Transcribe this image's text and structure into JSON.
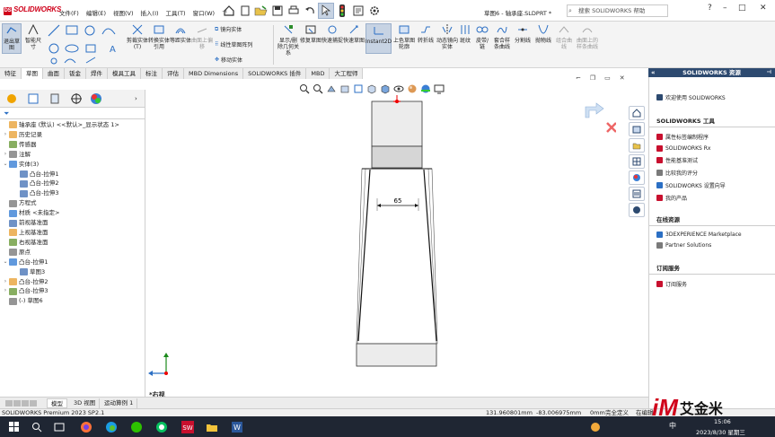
{
  "app": {
    "logo_text": "SOLIDWORKS",
    "title": "草图6 - 轴承座.SLDPRT *",
    "search_placeholder": "搜索 SOLIDWORKS 帮助",
    "accent_red": "#d0021b"
  },
  "menu": [
    "文件(F)",
    "编辑(E)",
    "视图(V)",
    "插入(I)",
    "工具(T)",
    "窗口(W)"
  ],
  "ribbon": {
    "buttons": [
      "退出草图",
      "智能尺寸",
      "剪裁实体(T)",
      "转换实体引用",
      "等距实体",
      "曲面上偏移",
      "显示/删除几何关系",
      "修复草图",
      "快速捕捉",
      "快速草图",
      "Instant2D",
      "上色草图轮廓",
      "转折线",
      "动态镜向实体",
      "斑纹",
      "皮带/链",
      "套合样条曲线",
      "分割线",
      "抛物线",
      "组合曲线",
      "曲面上的样条曲线"
    ],
    "mirror_label": "镜向实体",
    "linear_pattern_label": "线性草图阵列",
    "move_label": "移动实体"
  },
  "tabs": [
    "特征",
    "草图",
    "曲面",
    "钣金",
    "焊件",
    "模具工具",
    "标注",
    "评估",
    "MBD Dimensions",
    "SOLIDWORKS 插件",
    "MBD",
    "大工程师"
  ],
  "tabs_active_index": 1,
  "tree": [
    {
      "label": "轴承座 (默认) <<默认>_显示状态 1>",
      "indent": 0,
      "tw": ""
    },
    {
      "label": "历史记录",
      "indent": 0,
      "tw": "›"
    },
    {
      "label": "传感器",
      "indent": 0,
      "tw": ""
    },
    {
      "label": "注解",
      "indent": 0,
      "tw": "›"
    },
    {
      "label": "实体(3)",
      "indent": 0,
      "tw": "⌄"
    },
    {
      "label": "凸台-拉伸1",
      "indent": 1,
      "tw": ""
    },
    {
      "label": "凸台-拉伸2",
      "indent": 1,
      "tw": ""
    },
    {
      "label": "凸台-拉伸3",
      "indent": 1,
      "tw": ""
    },
    {
      "label": "方程式",
      "indent": 0,
      "tw": ""
    },
    {
      "label": "材质 <未指定>",
      "indent": 0,
      "tw": ""
    },
    {
      "label": "前视基准面",
      "indent": 0,
      "tw": ""
    },
    {
      "label": "上视基准面",
      "indent": 0,
      "tw": ""
    },
    {
      "label": "右视基准面",
      "indent": 0,
      "tw": ""
    },
    {
      "label": "原点",
      "indent": 0,
      "tw": ""
    },
    {
      "label": "凸台-拉伸1",
      "indent": 0,
      "tw": "⌄"
    },
    {
      "label": "草图3",
      "indent": 1,
      "tw": ""
    },
    {
      "label": "凸台-拉伸2",
      "indent": 0,
      "tw": "›"
    },
    {
      "label": "凸台-拉伸3",
      "indent": 0,
      "tw": "›"
    },
    {
      "label": "(-) 草图6",
      "indent": 0,
      "tw": ""
    }
  ],
  "viewport": {
    "dimension_value": "65",
    "view_label": "*右视"
  },
  "bottom_tabs": [
    "模型",
    "3D 视图",
    "运动算例 1"
  ],
  "status": {
    "version": "SOLIDWORKS Premium 2023 SP2.1",
    "x": "131.960801mm",
    "y": "-83.006975mm",
    "z": "0mm",
    "state": "完全定义",
    "editing": "在编辑"
  },
  "right_panel": {
    "header": "SOLIDWORKS 资源",
    "welcome": "欢迎使用 SOLIDWORKS",
    "section_tools": "SOLIDWORKS 工具",
    "tools": [
      "属性标签编制程序",
      "SOLIDWORKS Rx",
      "性能基准测试",
      "比较我的评分",
      "SOLIDWORKS 设置向导",
      "我的产品"
    ],
    "section_online": "在线资源",
    "online": [
      "3DEXPERIENCE Marketplace",
      "Partner Solutions"
    ],
    "section_sub": "订阅服务",
    "sub": [
      "订阅服务"
    ]
  },
  "taskbar": {
    "time": "15:06",
    "date": "2023/8/30 星期三",
    "ime": "中",
    "watermark": "艾金米"
  }
}
